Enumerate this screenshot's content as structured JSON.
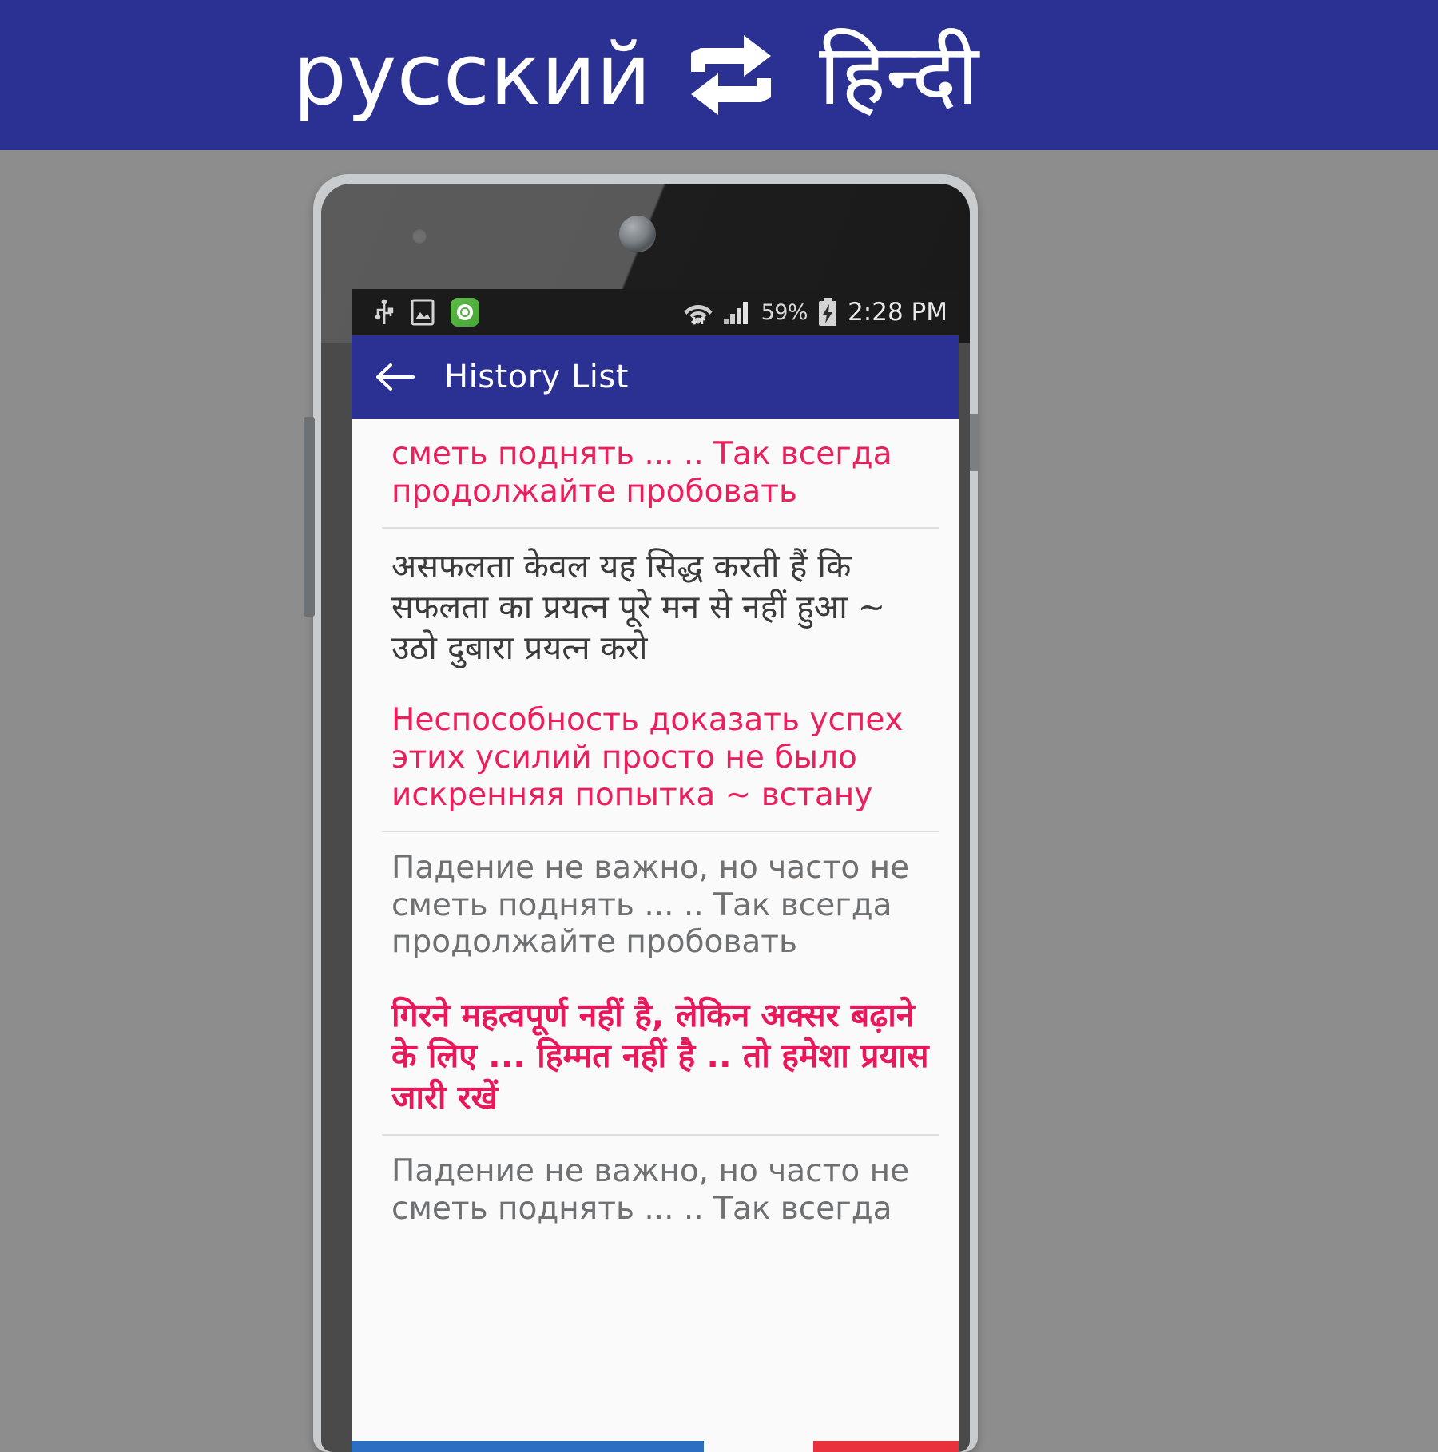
{
  "banner": {
    "source_language": "русский",
    "target_language": "हिन्दी",
    "swap_icon": "swap-repeat-icon",
    "background_color": "#2b3193",
    "text_color": "#ffffff"
  },
  "phone": {
    "statusbar": {
      "left_icons": [
        "usb-icon",
        "screenshot-icon",
        "app-notification-icon"
      ],
      "wifi_icon": "wifi-icon",
      "signal_icon": "cellular-signal-icon",
      "battery_percent": "59%",
      "battery_icon": "battery-charging-icon",
      "clock": "2:28 PM"
    },
    "appbar": {
      "back_icon": "back-arrow-icon",
      "title": "History List",
      "background_color": "#2b3193"
    },
    "history": {
      "items": [
        {
          "text": "сметь поднять ... .. Так всегда продолжайте пробовать",
          "style": "ru-pink",
          "color": "#eb1f5b"
        },
        {
          "text": "असफलता केवल यह सिद्ध करती हैं कि  सफलता का प्रयत्न पूरे मन से नहीं हुआ ~ उठो दुबारा प्रयत्न करो",
          "style": "hi-dark",
          "color": "#3b3b3b"
        },
        {
          "text": "Неспособность доказать успех этих усилий просто не было искренняя попытка ~ встану",
          "style": "ru-pink",
          "color": "#eb1f5b"
        },
        {
          "text": "Падение не важно, но часто не сметь поднять ... .. Так всегда продолжайте пробовать",
          "style": "ru-gray",
          "color": "#6f7072"
        },
        {
          "text": "गिरने महत्वपूर्ण नहीं है, लेकिन अक्सर बढ़ाने के लिए ... हिम्मत नहीं है .. तो हमेशा प्रयास जारी रखें",
          "style": "hi-pink",
          "color": "#e8185a"
        },
        {
          "text": "Падение не важно, но часто не сметь поднять ... .. Так всегда",
          "style": "ru-gray",
          "color": "#6f7072"
        }
      ]
    }
  }
}
